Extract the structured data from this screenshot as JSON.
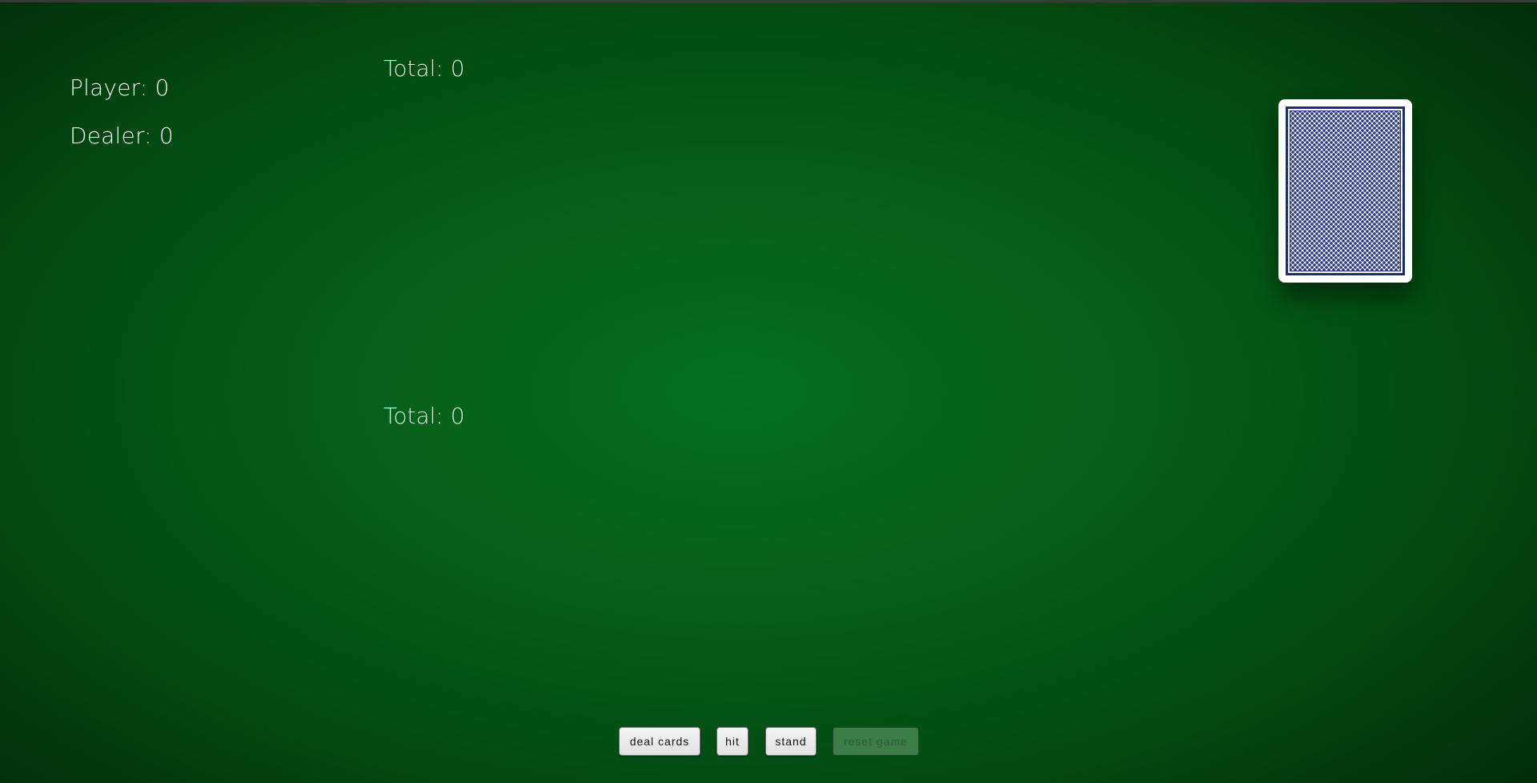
{
  "scoreboard": {
    "player": "Player: 0",
    "dealer": "Dealer: 0"
  },
  "dealer_hand": {
    "total": "Total: 0"
  },
  "player_hand": {
    "total": "Total: 0"
  },
  "deck": {
    "icon": "card-back-icon",
    "back_color": "#1f2f6e"
  },
  "controls": {
    "deal_label": "deal cards",
    "hit_label": "hit",
    "stand_label": "stand",
    "reset_label": "reset game",
    "reset_disabled": true
  },
  "colors": {
    "table_felt": "#05701f",
    "table_edge": "#022d09",
    "disabled_button": "#3c7d4a"
  }
}
